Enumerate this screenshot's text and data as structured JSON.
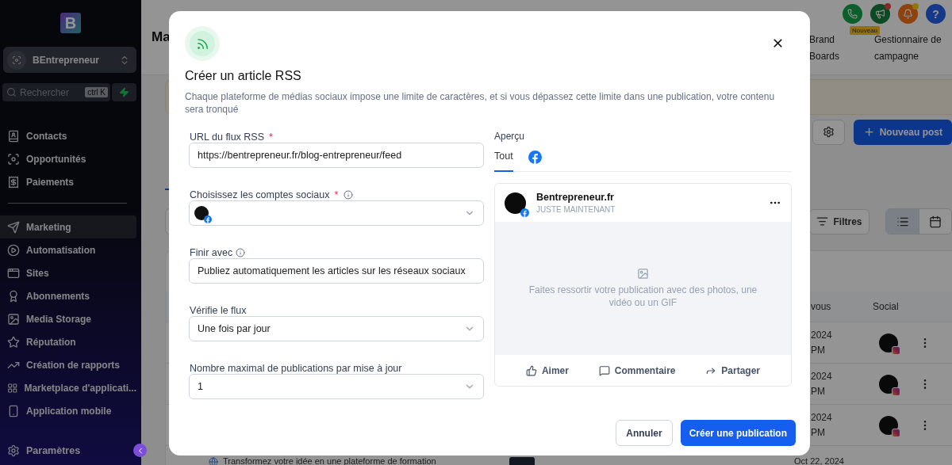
{
  "sidebar": {
    "logo": "B",
    "account": {
      "name": "BEntrepreneur"
    },
    "search": {
      "placeholder": "Rechercher",
      "shortcut": "ctrl K"
    },
    "nav_sections": [
      {
        "items": [
          {
            "label": "Contacts",
            "selected": false
          },
          {
            "label": "Opportunités",
            "selected": false
          },
          {
            "label": "Paiements",
            "selected": false
          }
        ]
      },
      {
        "items": [
          {
            "label": "Marketing",
            "selected": true
          },
          {
            "label": "Automatisation",
            "selected": false
          },
          {
            "label": "Sites",
            "selected": false
          },
          {
            "label": "Abonnements",
            "selected": false
          },
          {
            "label": "Media Storage",
            "selected": false
          },
          {
            "label": "Réputation",
            "selected": false
          },
          {
            "label": "Création de rapports",
            "selected": false
          },
          {
            "label": "Marketplace d'applicati...",
            "selected": false
          },
          {
            "label": "Application mobile",
            "selected": false
          }
        ]
      }
    ],
    "settings": "Paramètres"
  },
  "header": {
    "title": "Ma",
    "actions": [
      {
        "kind": "phone",
        "dot": false
      },
      {
        "kind": "megaphone",
        "dot": true
      },
      {
        "kind": "bell",
        "dot": true
      },
      {
        "kind": "help",
        "label": "?",
        "dot": false
      }
    ],
    "badge": "Nouveau",
    "links": [
      "Brand Boards",
      "Gestionnaire de campagne"
    ]
  },
  "page": {
    "new_post": "Nouveau post",
    "filters": "Filtres",
    "views": [
      {
        "kind": "list",
        "selected": true
      },
      {
        "kind": "calendar",
        "selected": false
      }
    ]
  },
  "table": {
    "columns": [
      "vous",
      "Social"
    ],
    "rows": [
      {
        "date": "2024",
        "time": "PM"
      },
      {
        "date": "2024",
        "time": "PM"
      },
      {
        "date": "2024",
        "time": "PM"
      }
    ],
    "last_row": {
      "title": "Transformez votre idée en une plateforme de formation",
      "date": "Oct 22, 2024"
    }
  },
  "modal": {
    "title": "Créer un article RSS",
    "required_mark": "*",
    "description": "Chaque plateforme de médias sociaux impose une limite de caractères, et si vous dépassez cette limite dans une publication, votre contenu sera tronqué",
    "fields": [
      {
        "kind": "text",
        "label": "URL du flux RSS",
        "required": true,
        "info": false,
        "value": "https://bentrepreneur.fr/blog-entrepreneur/feed"
      },
      {
        "kind": "accounts",
        "label": "Choisissez les comptes sociaux",
        "required": true,
        "info": true
      },
      {
        "kind": "text",
        "label": "Finir avec",
        "required": false,
        "info": true,
        "value": "Publiez automatiquement les articles sur les réseaux sociaux"
      },
      {
        "kind": "select",
        "label": "Vérifie le flux",
        "required": false,
        "info": false,
        "value": "Une fois par jour"
      },
      {
        "kind": "select",
        "label": "Nombre maximal de publications par mise à jour",
        "required": false,
        "info": false,
        "value": "1"
      }
    ],
    "preview": {
      "title": "Aperçu",
      "tabs": [
        {
          "kind": "text",
          "label": "Tout",
          "selected": true
        },
        {
          "kind": "facebook",
          "selected": false
        }
      ],
      "post": {
        "name": "Bentrepreneur.fr",
        "time": "JUSTE MAINTENANT",
        "placeholder": "Faites ressortir votre publication avec des photos, une vidéo ou un GIF",
        "actions": [
          "Aimer",
          "Commentaire",
          "Partager"
        ]
      }
    },
    "buttons": {
      "cancel": "Annuler",
      "submit": "Créer une publication"
    }
  }
}
